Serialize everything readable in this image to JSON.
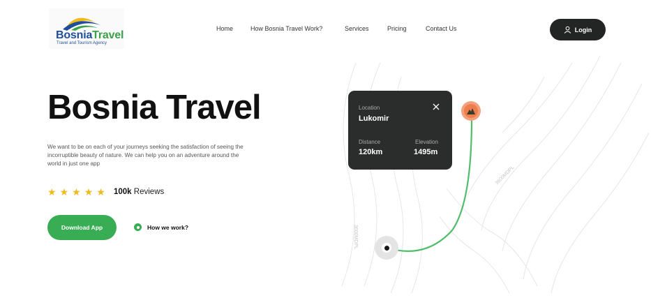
{
  "brand": {
    "name_part1": "Bosnia",
    "name_part2": "Travel",
    "tagline": "Travel and Tourism Agency"
  },
  "nav": {
    "items": [
      "Home",
      "How Bosnia Travel Work?",
      "Services",
      "Pricing",
      "Contact Us"
    ]
  },
  "login": {
    "label": "Login",
    "icon": "user-icon"
  },
  "hero": {
    "title": "Bosnia Travel",
    "description": "We want to be on each of your journeys seeking the satisfaction of seeing the incorruptible beauty of nature. We can help you on an adventure around the world in just one app",
    "rating": {
      "stars": 5,
      "count": "100k",
      "label": "Reviews"
    },
    "download_label": "Download App",
    "how_label": "How we work?"
  },
  "map": {
    "contour_labels": [
      "3600MDPL",
      "3600MDPL"
    ],
    "card": {
      "location_label": "Location",
      "location_value": "Lukomir",
      "distance_label": "Distance",
      "distance_value": "120km",
      "elevation_label": "Elevation",
      "elevation_value": "1495m"
    }
  },
  "colors": {
    "accent_green": "#38ad54",
    "dark": "#222523",
    "star": "#f2b91a",
    "pin": "#ee7e4e"
  }
}
